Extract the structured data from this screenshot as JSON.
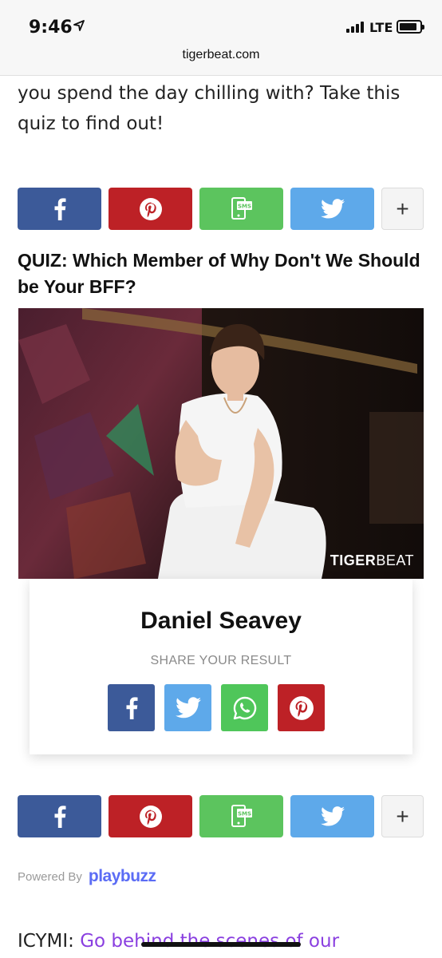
{
  "status": {
    "time": "9:46",
    "network": "LTE"
  },
  "browser": {
    "url": "tigerbeat.com"
  },
  "article": {
    "intro_line1": "you spend the day chilling with? Take this",
    "intro_line2": "quiz to find out!",
    "quiz_title": "QUIZ: Which Member of Why Don't We Should be Your BFF?",
    "icymi_label": "ICYMI:",
    "icymi_link": "Go behind the scenes of our"
  },
  "share_bar": {
    "more_label": "+"
  },
  "photo": {
    "watermark_bold": "TIGER",
    "watermark_regular": "BEAT"
  },
  "result": {
    "name": "Daniel Seavey",
    "share_label": "SHARE YOUR RESULT"
  },
  "footer": {
    "powered_label": "Powered By",
    "brand": "playbuzz"
  },
  "colors": {
    "facebook": "#3c5a99",
    "pinterest": "#bd2126",
    "sms": "#5cc45e",
    "twitter": "#5ea9ea",
    "whatsapp": "#4fc65a",
    "link": "#8a3fe0",
    "playbuzz": "#5b6cf5"
  },
  "icons": [
    "location-arrow-icon",
    "signal-icon",
    "battery-icon",
    "facebook-icon",
    "pinterest-icon",
    "sms-icon",
    "twitter-icon",
    "whatsapp-icon",
    "plus-icon"
  ]
}
